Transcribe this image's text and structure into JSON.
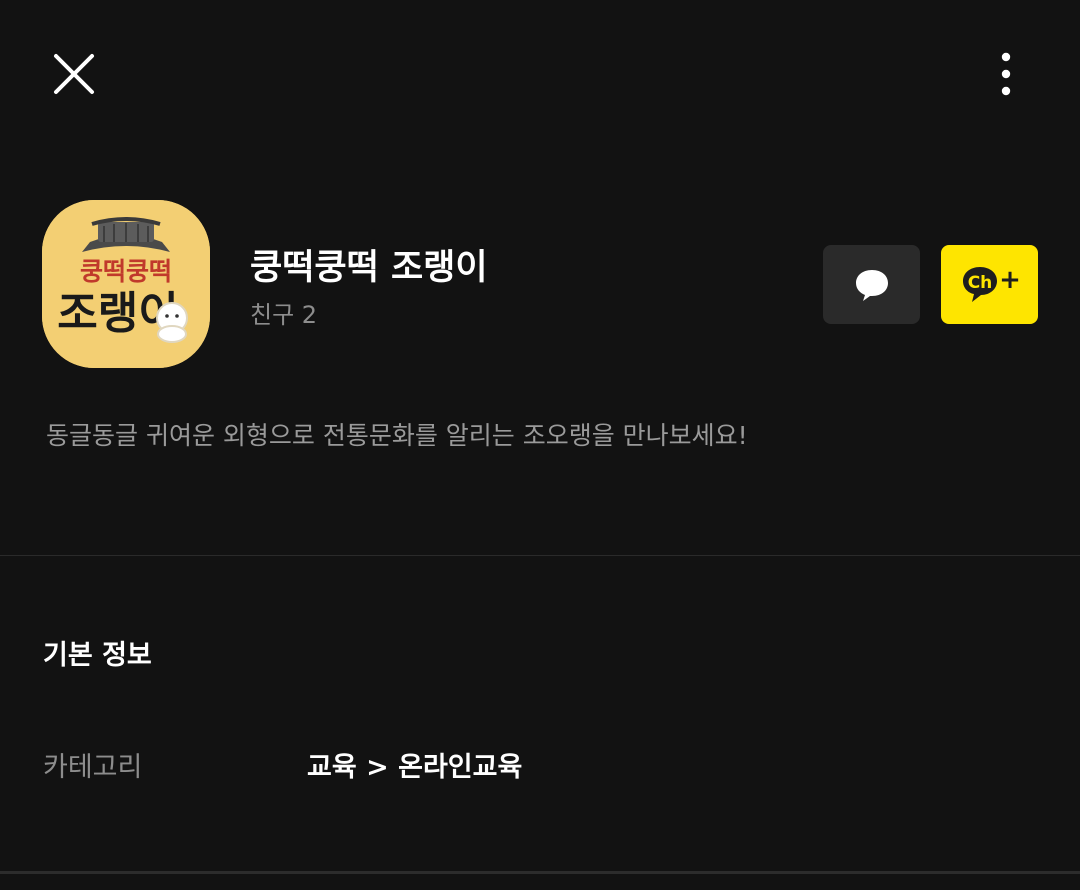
{
  "topbar": {
    "close_icon": "close-icon",
    "more_icon": "more-vertical-icon"
  },
  "profile": {
    "name": "쿵떡쿵떡 조랭이",
    "friends": "친구 2",
    "avatar": {
      "top_text": "쿵떡쿵떡",
      "main_text": "조랭이",
      "background_color": "#f3cf73"
    },
    "chat_icon": "chat-bubble-icon",
    "add_channel_label": "Ch",
    "add_channel_plus": "+",
    "add_channel_color": "#fee500"
  },
  "description": "동글동글 귀여운 외형으로 전통문화를 알리는 조오랭을 만나보세요!",
  "basic_info": {
    "title": "기본 정보",
    "rows": [
      {
        "label": "카테고리",
        "value": "교육 > 온라인교육"
      }
    ]
  }
}
